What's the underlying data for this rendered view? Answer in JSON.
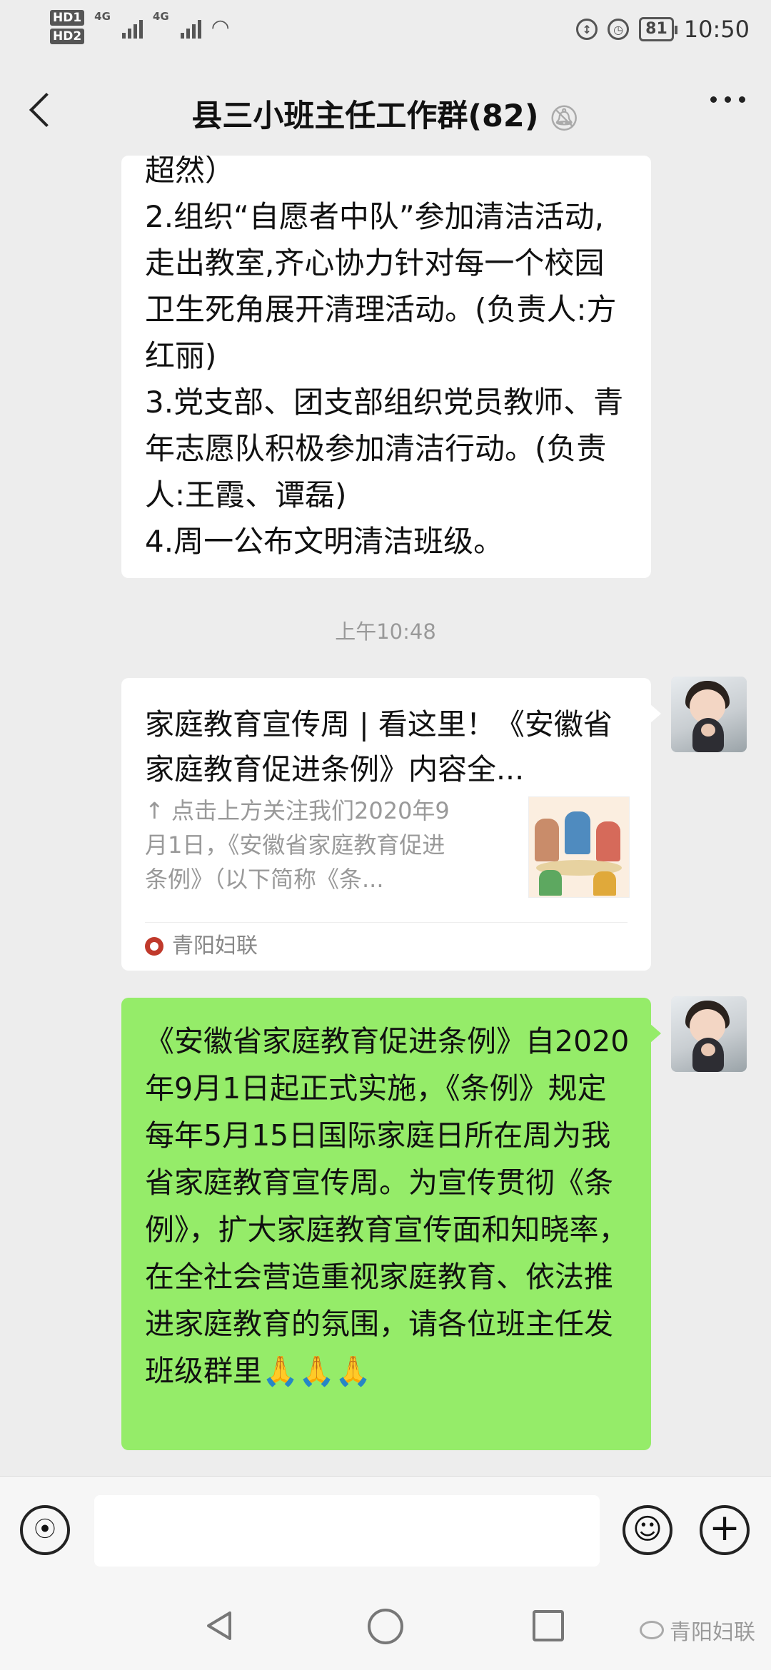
{
  "status_bar": {
    "hd1": "HD1",
    "hd2": "HD2",
    "signal1_label": "4G",
    "signal2_label": "4G",
    "battery": "81",
    "time": "10:50"
  },
  "header": {
    "title": "县三小班主任工作群(82)"
  },
  "messages": {
    "m1_text": "超然）\n2.组织“自愿者中队”参加清洁活动, 走出教室,齐心协力针对每一个校园卫生死角展开清理活动。(负责人:方红丽)\n3.党支部、团支部组织党员教师、青年志愿队积极参加清洁行动。(负责人:王霞、谭磊)\n4.周一公布文明清洁班级。",
    "timestamp": "上午10:48",
    "card_title": "家庭教育宣传周 | 看这里！《安徽省家庭教育促进条例》内容全...",
    "card_desc": "↑ 点击上方关注我们2020年9月1日，《安徽省家庭教育促进条例》（以下简称《条...",
    "card_source": "青阳妇联",
    "m3_text": "《安徽省家庭教育促进条例》自2020年9月1日起正式实施，《条例》规定每年5月15日国际家庭日所在周为我省家庭教育宣传周。为宣传贯彻《条例》，扩大家庭教育宣传面和知晓率，在全社会营造重视家庭教育、依法推进家庭教育的氛围，请各位班主任发班级群里🙏🙏🙏"
  },
  "watermark": "青阳妇联"
}
